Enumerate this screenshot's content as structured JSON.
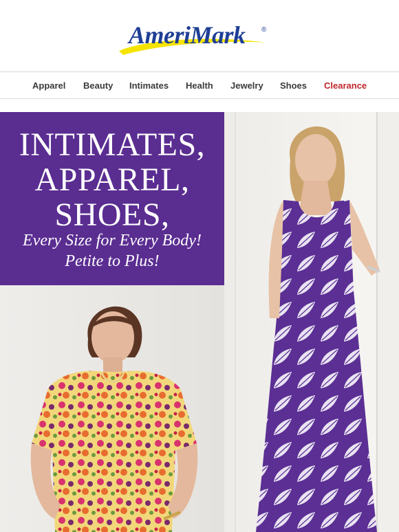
{
  "brand": {
    "name": "AmeriMark",
    "registered_mark": "®",
    "swoosh_color": "#f5e400",
    "text_color": "#1f3f95"
  },
  "nav": {
    "items": [
      {
        "label": "Apparel"
      },
      {
        "label": "Beauty"
      },
      {
        "label": "Intimates"
      },
      {
        "label": "Health"
      },
      {
        "label": "Jewelry"
      },
      {
        "label": "Shoes"
      },
      {
        "label": "Clearance",
        "color": "#c0262d"
      }
    ]
  },
  "hero": {
    "headline_lines": [
      "INTIMATES,",
      "APPAREL,",
      "SHOES,"
    ],
    "subline_lines": [
      "Every Size for Every Body!",
      "Petite to Plus!"
    ],
    "panel_color": "#5a2d91"
  },
  "images": {
    "left": "photo-floral-print-dress-model",
    "right": "photo-purple-leaf-print-dress-model"
  }
}
